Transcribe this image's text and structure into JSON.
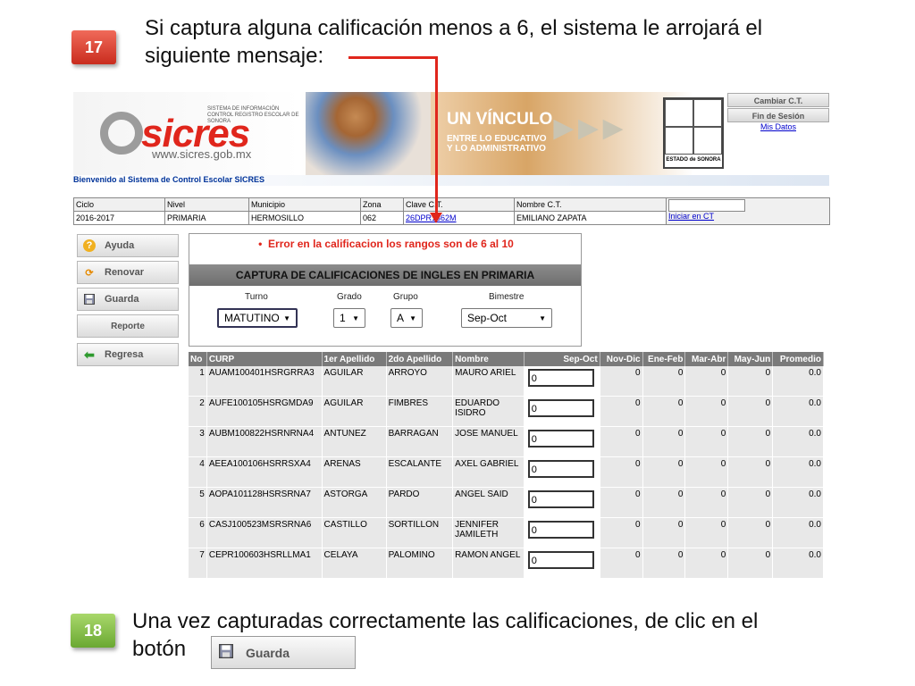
{
  "slide": {
    "step17": "17",
    "text17_line1": "Si captura alguna calificación menos a 6, el sistema le arrojará el",
    "text17_line2": "siguiente mensaje:",
    "step18": "18",
    "text18_line1": "Una vez capturadas correctamente las calificaciones, de clic en el",
    "text18_line2": "botón",
    "guarda_label": "Guarda"
  },
  "banner": {
    "logo_text": "sicres",
    "site": "www.sicres.gob.mx",
    "small_text": "SISTEMA DE INFORMACIÓN CONTROL REGISTRO ESCOLAR DE SONORA",
    "slogan": "UN VÍNCULO",
    "slogan_sub1": "ENTRE LO EDUCATIVO",
    "slogan_sub2": "Y LO ADMINISTRATIVO",
    "crest_label": "ESTADO de SONORA"
  },
  "top_links": {
    "cambiar": "Cambiar C.T.",
    "fin": "Fin de Sesión",
    "mis_datos": "Mis Datos"
  },
  "welcome": "Bienvenido al Sistema de Control Escolar SICRES",
  "info": {
    "headers": [
      "Ciclo",
      "Nivel",
      "Municipio",
      "Zona",
      "Clave C.T.",
      "Nombre C.T."
    ],
    "values": [
      "2016-2017",
      "PRIMARIA",
      "HERMOSILLO",
      "062",
      "26DPR1362M",
      "EMILIANO ZAPATA"
    ],
    "iniciar": "Iniciar en CT"
  },
  "menu": {
    "ayuda": "Ayuda",
    "renovar": "Renovar",
    "guarda": "Guarda",
    "reporte": "Reporte",
    "regresa": "Regresa"
  },
  "panel": {
    "error": "Error en la calificacion los rangos son de 6 al 10",
    "title": "CAPTURA DE CALIFICACIONES DE INGLES EN PRIMARIA",
    "turno_label": "Turno",
    "turno_value": "MATUTINO",
    "grado_label": "Grado",
    "grado_value": "1",
    "grupo_label": "Grupo",
    "grupo_value": "A",
    "bimestre_label": "Bimestre",
    "bimestre_value": "Sep-Oct"
  },
  "grades": {
    "headers": [
      "No",
      "CURP",
      "1er Apellido",
      "2do Apellido",
      "Nombre",
      "Sep-Oct",
      "Nov-Dic",
      "Ene-Feb",
      "Mar-Abr",
      "May-Jun",
      "Promedio"
    ],
    "rows": [
      {
        "no": "1",
        "curp": "AUAM100401HSRGRRA3",
        "ap1": "AGUILAR",
        "ap2": "ARROYO",
        "nombre": "MAURO ARIEL",
        "sep": "0",
        "nov": "0",
        "ene": "0",
        "mar": "0",
        "may": "0",
        "prom": "0.0"
      },
      {
        "no": "2",
        "curp": "AUFE100105HSRGMDA9",
        "ap1": "AGUILAR",
        "ap2": "FIMBRES",
        "nombre": "EDUARDO ISIDRO",
        "sep": "0",
        "nov": "0",
        "ene": "0",
        "mar": "0",
        "may": "0",
        "prom": "0.0"
      },
      {
        "no": "3",
        "curp": "AUBM100822HSRNRNA4",
        "ap1": "ANTUNEZ",
        "ap2": "BARRAGAN",
        "nombre": "JOSE MANUEL",
        "sep": "0",
        "nov": "0",
        "ene": "0",
        "mar": "0",
        "may": "0",
        "prom": "0.0"
      },
      {
        "no": "4",
        "curp": "AEEA100106HSRRSXA4",
        "ap1": "ARENAS",
        "ap2": "ESCALANTE",
        "nombre": "AXEL GABRIEL",
        "sep": "0",
        "nov": "0",
        "ene": "0",
        "mar": "0",
        "may": "0",
        "prom": "0.0"
      },
      {
        "no": "5",
        "curp": "AOPA101128HSRSRNA7",
        "ap1": "ASTORGA",
        "ap2": "PARDO",
        "nombre": "ANGEL SAID",
        "sep": "0",
        "nov": "0",
        "ene": "0",
        "mar": "0",
        "may": "0",
        "prom": "0.0"
      },
      {
        "no": "6",
        "curp": "CASJ100523MSRSRNA6",
        "ap1": "CASTILLO",
        "ap2": "SORTILLON",
        "nombre": "JENNIFER JAMILETH",
        "sep": "0",
        "nov": "0",
        "ene": "0",
        "mar": "0",
        "may": "0",
        "prom": "0.0"
      },
      {
        "no": "7",
        "curp": "CEPR100603HSRLLMA1",
        "ap1": "CELAYA",
        "ap2": "PALOMINO",
        "nombre": "RAMON ANGEL",
        "sep": "0",
        "nov": "0",
        "ene": "0",
        "mar": "0",
        "may": "0",
        "prom": "0.0"
      }
    ]
  },
  "icons": {
    "ayuda": "help-icon",
    "renovar": "refresh-icon",
    "guarda": "floppy-disk-icon",
    "regresa": "arrow-left-icon"
  },
  "colors": {
    "error_red": "#e0261c",
    "title_bar": "#7a7a7a",
    "badge17": "#d8392a",
    "badge18": "#7fbf3f"
  }
}
